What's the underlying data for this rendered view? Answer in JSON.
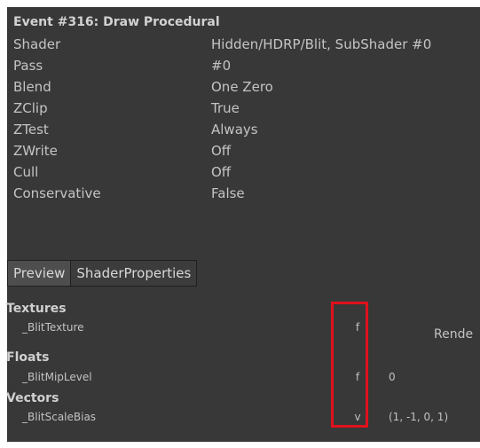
{
  "event": {
    "title": "Event #316: Draw Procedural"
  },
  "state": [
    {
      "label": "Shader",
      "value": "Hidden/HDRP/Blit, SubShader #0"
    },
    {
      "label": "Pass",
      "value": "#0"
    },
    {
      "label": "Blend",
      "value": "One Zero"
    },
    {
      "label": "ZClip",
      "value": "True"
    },
    {
      "label": "ZTest",
      "value": "Always"
    },
    {
      "label": "ZWrite",
      "value": "Off"
    },
    {
      "label": "Cull",
      "value": "Off"
    },
    {
      "label": "Conservative",
      "value": "False"
    }
  ],
  "tabs": [
    "Preview",
    "ShaderProperties"
  ],
  "sections": {
    "textures": {
      "header": "Textures",
      "items": [
        {
          "name": "_BlitTexture",
          "type": "f",
          "value": "Rende"
        }
      ]
    },
    "floats": {
      "header": "Floats",
      "items": [
        {
          "name": "_BlitMipLevel",
          "type": "f",
          "value": "0"
        }
      ]
    },
    "vectors": {
      "header": "Vectors",
      "items": [
        {
          "name": "_BlitScaleBias",
          "type": "v",
          "value": "(1, -1, 0, 1)"
        }
      ]
    }
  },
  "colors": {
    "panel_bg": "#383838",
    "highlight": "#e0111b",
    "tab_active": "#4e4e4e"
  }
}
